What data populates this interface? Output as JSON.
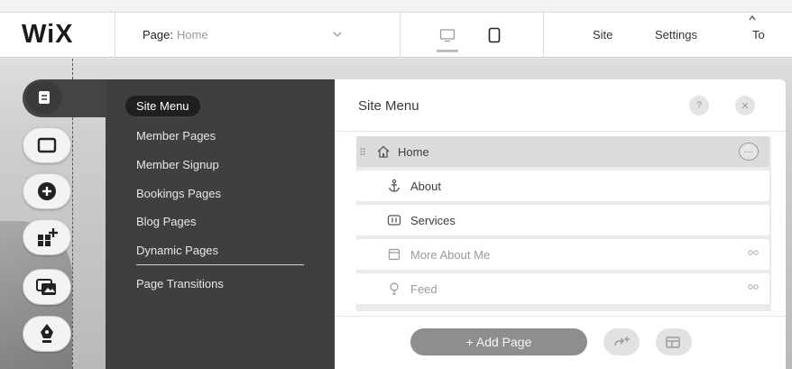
{
  "brand": {
    "logo": "WiX"
  },
  "topbar": {
    "page_label": "Page:",
    "page_value": "Home",
    "devices": [
      "desktop-icon",
      "mobile-icon"
    ],
    "links": {
      "site": "Site",
      "settings": "Settings",
      "tools": "To"
    }
  },
  "rail": {
    "buttons": [
      "pages-icon",
      "background-icon",
      "add-icon",
      "add-apps-icon",
      "media-icon",
      "blog-icon"
    ]
  },
  "menu": {
    "items": [
      {
        "label": "Site Menu",
        "active": true
      },
      {
        "label": "Member Pages"
      },
      {
        "label": "Member Signup"
      },
      {
        "label": "Bookings Pages"
      },
      {
        "label": "Blog Pages"
      },
      {
        "label": "Dynamic Pages"
      },
      {
        "label": "Page Transitions"
      }
    ]
  },
  "site_menu": {
    "title": "Site Menu",
    "help": "?",
    "close": "✕",
    "pages": [
      {
        "name": "Home",
        "icon": "home-icon",
        "selected": true,
        "hidden": false
      },
      {
        "name": "About",
        "icon": "anchor-icon",
        "selected": false,
        "hidden": false
      },
      {
        "name": "Services",
        "icon": "services-icon",
        "selected": false,
        "hidden": false
      },
      {
        "name": "More About Me",
        "icon": "page-icon",
        "selected": false,
        "hidden": true
      },
      {
        "name": "Feed",
        "icon": "feed-icon",
        "selected": false,
        "hidden": true
      }
    ],
    "add_page": "+ Add Page",
    "footer_buttons": [
      "add-link-icon",
      "add-folder-icon"
    ]
  }
}
